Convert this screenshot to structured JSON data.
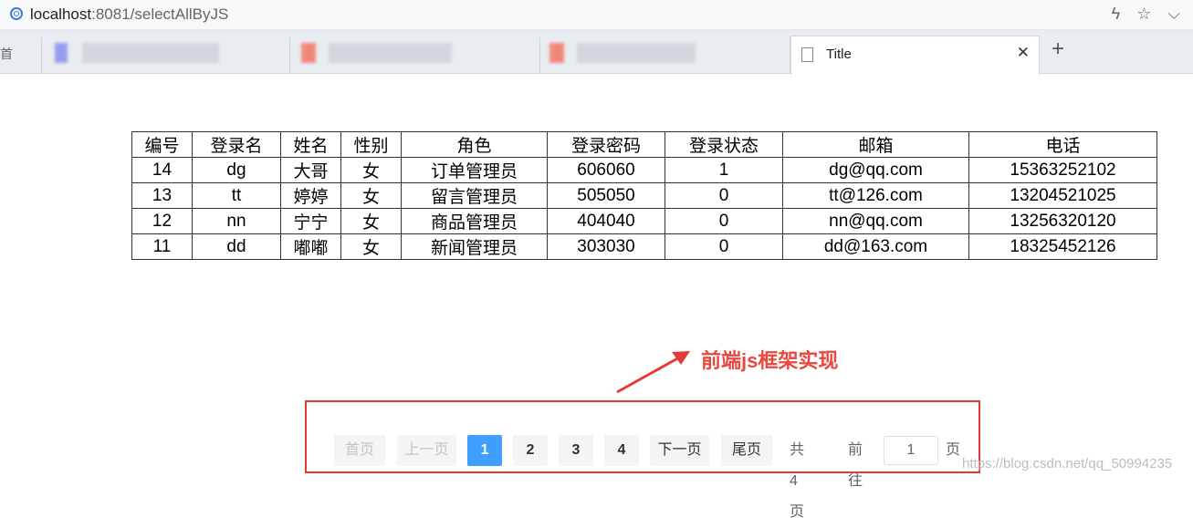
{
  "browser": {
    "url_host": "localhost",
    "url_rest": ":8081/selectAllByJS",
    "tab_title": "Title",
    "tab_close": "✕",
    "new_tab": "+",
    "left_tab_fragment": "首"
  },
  "table": {
    "headers": [
      "编号",
      "登录名",
      "姓名",
      "性别",
      "角色",
      "登录密码",
      "登录状态",
      "邮箱",
      "电话"
    ],
    "rows": [
      [
        "14",
        "dg",
        "大哥",
        "女",
        "订单管理员",
        "606060",
        "1",
        "dg@qq.com",
        "15363252102"
      ],
      [
        "13",
        "tt",
        "婷婷",
        "女",
        "留言管理员",
        "505050",
        "0",
        "tt@126.com",
        "13204521025"
      ],
      [
        "12",
        "nn",
        "宁宁",
        "女",
        "商品管理员",
        "404040",
        "0",
        "nn@qq.com",
        "13256320120"
      ],
      [
        "11",
        "dd",
        "嘟嘟",
        "女",
        "新闻管理员",
        "303030",
        "0",
        "dd@163.com",
        "18325452126"
      ]
    ]
  },
  "annotation": {
    "text": "前端js框架实现",
    "color": "#e53935"
  },
  "pagination": {
    "first": "首页",
    "prev": "上一页",
    "pages": [
      "1",
      "2",
      "3",
      "4"
    ],
    "current_page": "1",
    "next": "下一页",
    "last": "尾页",
    "total": "共 4 页",
    "goto_label": "前往",
    "goto_value": "1",
    "goto_suffix": "页",
    "accent": "#409eff"
  },
  "watermark": "https://blog.csdn.net/qq_50994235"
}
